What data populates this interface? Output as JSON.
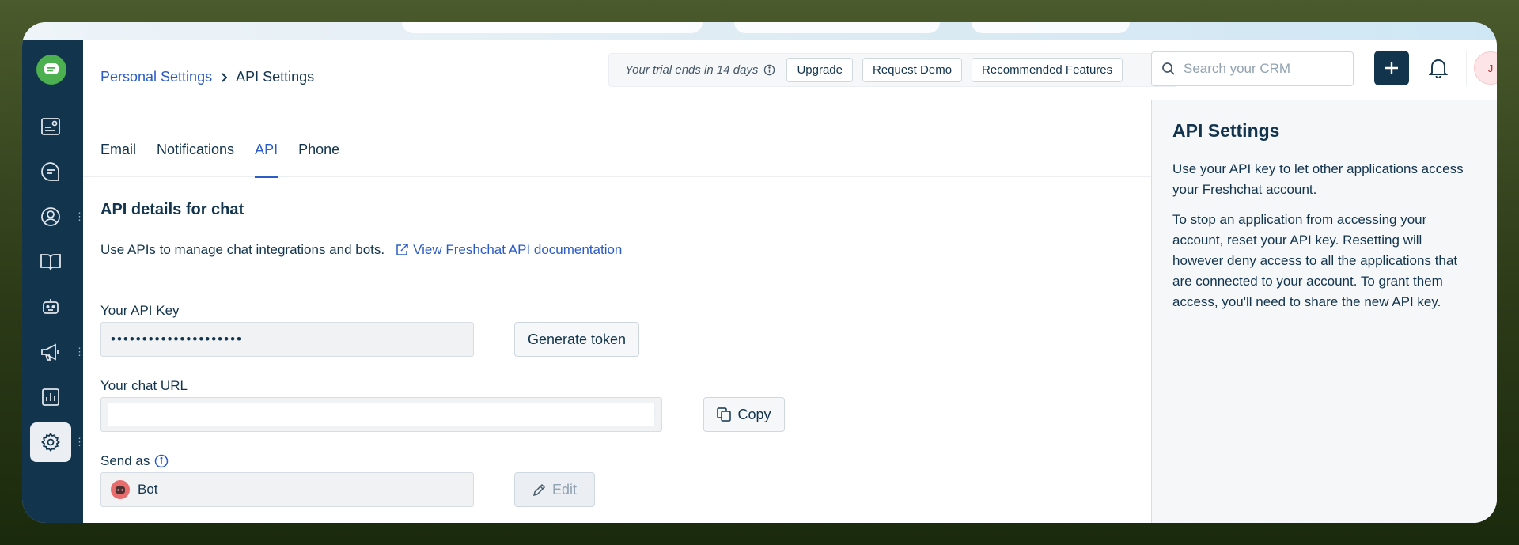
{
  "breadcrumb": {
    "parent": "Personal Settings",
    "current": "API Settings"
  },
  "trial": {
    "text": "Your trial ends in 14 days",
    "upgrade": "Upgrade",
    "request_demo": "Request Demo",
    "recommended": "Recommended Features"
  },
  "search": {
    "placeholder": "Search your CRM"
  },
  "avatar": {
    "initial": "J"
  },
  "tabs": [
    {
      "label": "Email"
    },
    {
      "label": "Notifications"
    },
    {
      "label": "API"
    },
    {
      "label": "Phone"
    }
  ],
  "main": {
    "section_title": "API details for chat",
    "description": "Use APIs to manage chat integrations and bots.",
    "doc_link": "View Freshchat API documentation",
    "api_key_label": "Your API Key",
    "api_key_value": "•••••••••••••••••••••",
    "generate_token": "Generate token",
    "chat_url_label": "Your chat URL",
    "chat_url_value": "",
    "copy": "Copy",
    "send_as_label": "Send as",
    "send_as_value": "Bot",
    "edit": "Edit"
  },
  "right_panel": {
    "title": "API Settings",
    "p1": "Use your API key to let other applications access your Freshchat account.",
    "p2": "To stop an application from accessing your account, reset your API key. Resetting will however deny access to all the applications that are connected to your account. To grant them access, you'll need to share the new API key."
  },
  "colors": {
    "sidebar": "#12344d",
    "accent": "#2c5cc5",
    "logo": "#4caf50"
  },
  "icons": {
    "sidebar": [
      "dashboard-icon",
      "conversations-icon",
      "contacts-icon",
      "knowledge-base-icon",
      "bot-icon",
      "campaigns-icon",
      "analytics-icon",
      "settings-icon"
    ]
  }
}
